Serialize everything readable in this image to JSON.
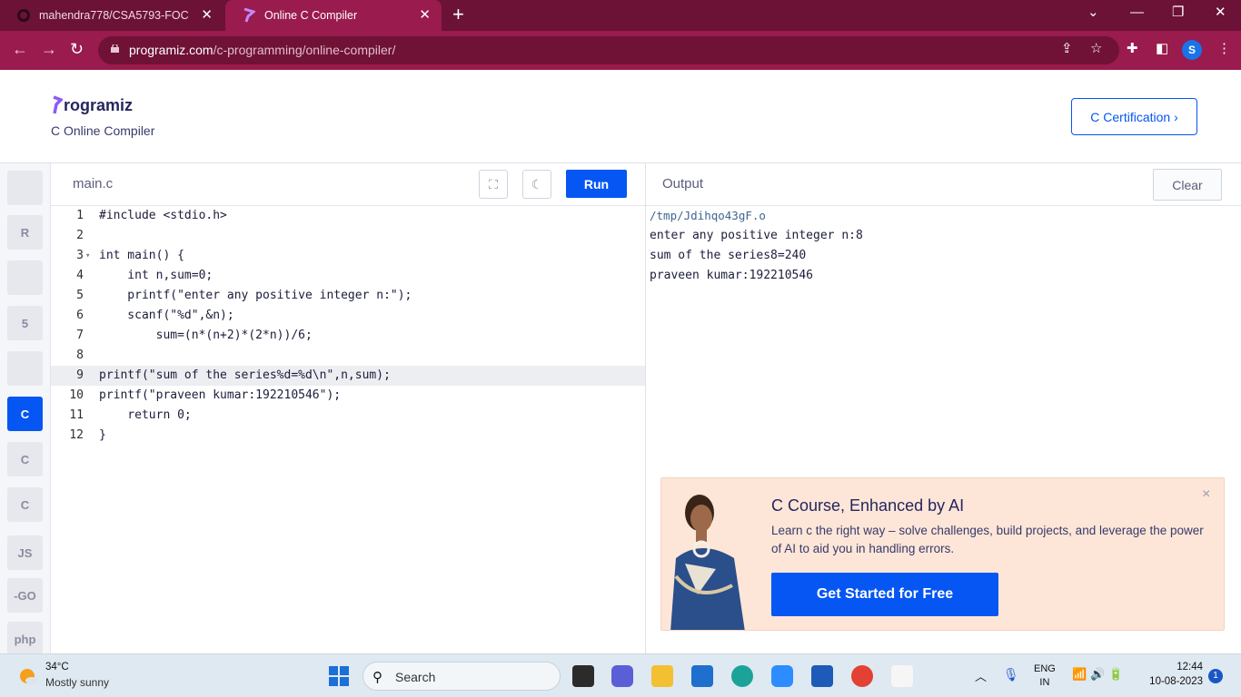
{
  "browser": {
    "tabs": [
      {
        "title": "mahendra778/CSA5793-FOC",
        "active": false
      },
      {
        "title": "Online C Compiler",
        "active": true
      }
    ],
    "url_host": "programiz.com",
    "url_path": "/c-programming/online-compiler/",
    "profile_initial": "S",
    "colors": {
      "frame": "#6b1236",
      "toolbar": "#9a1b4d"
    }
  },
  "header": {
    "logo": "rogramiz",
    "subtitle": "C Online Compiler",
    "cert_button": "C Certification ›"
  },
  "sidebar": {
    "languages": [
      {
        "name": "python-icon",
        "glyph": "",
        "active": false
      },
      {
        "name": "r-icon",
        "glyph": "R",
        "active": false
      },
      {
        "name": "sql-icon",
        "glyph": "",
        "active": false
      },
      {
        "name": "html-icon",
        "glyph": "5",
        "active": false
      },
      {
        "name": "java-icon",
        "glyph": "",
        "active": false
      },
      {
        "name": "c-icon",
        "glyph": "C",
        "active": true
      },
      {
        "name": "cpp-icon",
        "glyph": "C",
        "active": false
      },
      {
        "name": "csharp-icon",
        "glyph": "C",
        "active": false
      },
      {
        "name": "js-icon",
        "glyph": "JS",
        "active": false
      },
      {
        "name": "go-icon",
        "glyph": "-GO",
        "active": false
      },
      {
        "name": "php-icon",
        "glyph": "php",
        "active": false
      }
    ]
  },
  "editor": {
    "file_name": "main.c",
    "run_label": "Run",
    "highlight_line": 9,
    "lines": [
      {
        "num": "1",
        "text": "#include <stdio.h>"
      },
      {
        "num": "2",
        "text": ""
      },
      {
        "num": "3",
        "text": "int main() {"
      },
      {
        "num": "4",
        "text": "    int n,sum=0;"
      },
      {
        "num": "5",
        "text": "    printf(\"enter any positive integer n:\");"
      },
      {
        "num": "6",
        "text": "    scanf(\"%d\",&n);"
      },
      {
        "num": "7",
        "text": "        sum=(n*(n+2)*(2*n))/6;"
      },
      {
        "num": "8",
        "text": ""
      },
      {
        "num": "9",
        "text": "printf(\"sum of the series%d=%d\\n\",n,sum);"
      },
      {
        "num": "10",
        "text": "printf(\"praveen kumar:192210546\");"
      },
      {
        "num": "11",
        "text": "    return 0;"
      },
      {
        "num": "12",
        "text": "}"
      }
    ]
  },
  "output": {
    "title": "Output",
    "clear_label": "Clear",
    "lines": [
      "/tmp/Jdihqo43gF.o",
      "enter any positive integer n:8",
      "sum of the series8=240",
      "praveen kumar:192210546"
    ]
  },
  "promo": {
    "title": "C Course, Enhanced by AI",
    "description": "Learn c the right way – solve challenges, build projects, and leverage the power of AI to aid you in handling errors.",
    "cta": "Get Started for Free",
    "close": "×"
  },
  "taskbar": {
    "weather_temp": "34°C",
    "weather_desc": "Mostly sunny",
    "search_label": "Search",
    "lang_line1": "ENG",
    "lang_line2": "IN",
    "time": "12:44",
    "date": "10-08-2023",
    "notifications": "1"
  }
}
